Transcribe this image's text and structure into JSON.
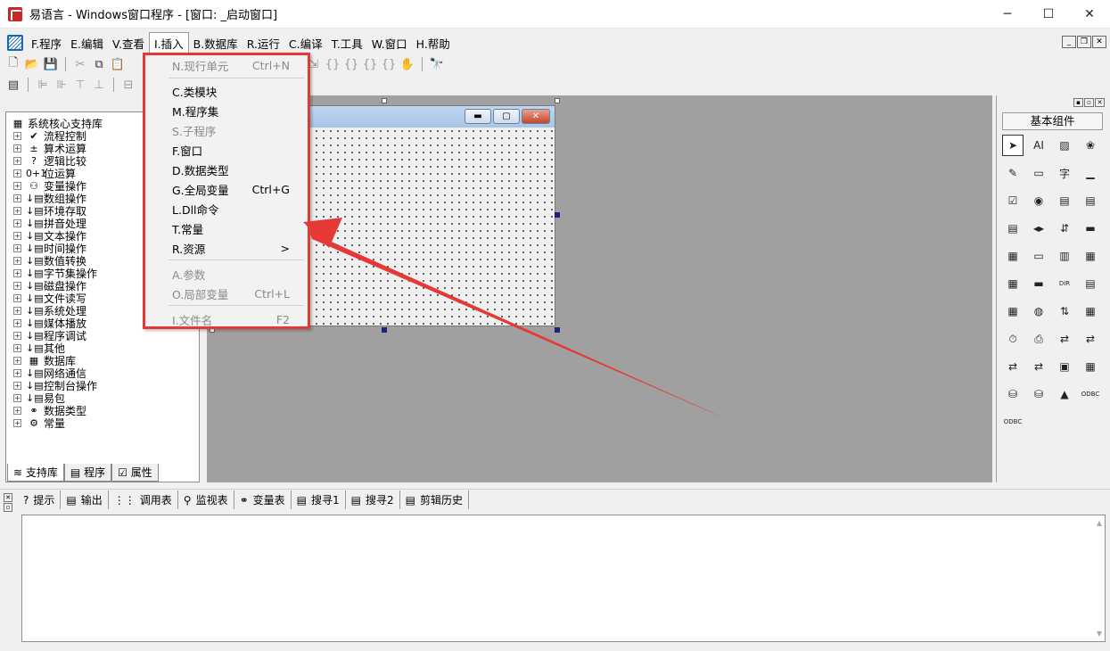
{
  "window": {
    "title": "易语言 - Windows窗口程序 - [窗口: _启动窗口]"
  },
  "menubar": {
    "items": [
      {
        "label": "F.程序",
        "key": "F"
      },
      {
        "label": "E.编辑",
        "key": "E"
      },
      {
        "label": "V.查看",
        "key": "V"
      },
      {
        "label": "I.插入",
        "key": "I"
      },
      {
        "label": "B.数据库",
        "key": "B"
      },
      {
        "label": "R.运行",
        "key": "R"
      },
      {
        "label": "C.编译",
        "key": "C"
      },
      {
        "label": "T.工具",
        "key": "T"
      },
      {
        "label": "W.窗口",
        "key": "W"
      },
      {
        "label": "H.帮助",
        "key": "H"
      }
    ]
  },
  "insert_menu": {
    "items": [
      {
        "label": "N.现行单元",
        "shortcut": "Ctrl+N",
        "enabled": false
      },
      {
        "label": "C.类模块",
        "shortcut": "",
        "enabled": true
      },
      {
        "label": "M.程序集",
        "shortcut": "",
        "enabled": true
      },
      {
        "label": "S.子程序",
        "shortcut": "",
        "enabled": false
      },
      {
        "label": "F.窗口",
        "shortcut": "",
        "enabled": true
      },
      {
        "label": "D.数据类型",
        "shortcut": "",
        "enabled": true
      },
      {
        "label": "G.全局变量",
        "shortcut": "Ctrl+G",
        "enabled": true
      },
      {
        "label": "L.Dll命令",
        "shortcut": "",
        "enabled": true
      },
      {
        "label": "T.常量",
        "shortcut": "",
        "enabled": true
      },
      {
        "label": "R.资源",
        "shortcut": ">",
        "enabled": true
      },
      {
        "label": "A.参数",
        "shortcut": "",
        "enabled": false
      },
      {
        "label": "O.局部变量",
        "shortcut": "Ctrl+L",
        "enabled": false
      },
      {
        "label": "I.文件名",
        "shortcut": "F2",
        "enabled": false
      }
    ]
  },
  "left_panel": {
    "root": "系统核心支持库",
    "items": [
      {
        "label": "流程控制",
        "icon": "✔"
      },
      {
        "label": "算术运算",
        "icon": "±"
      },
      {
        "label": "逻辑比较",
        "icon": "?"
      },
      {
        "label": "位运算",
        "icon": "0+1"
      },
      {
        "label": "变量操作",
        "icon": "⚇"
      },
      {
        "label": "数组操作",
        "icon": "↓▤"
      },
      {
        "label": "环境存取",
        "icon": "↓▤"
      },
      {
        "label": "拼音处理",
        "icon": "↓▤"
      },
      {
        "label": "文本操作",
        "icon": "↓▤"
      },
      {
        "label": "时间操作",
        "icon": "↓▤"
      },
      {
        "label": "数值转换",
        "icon": "↓▤"
      },
      {
        "label": "字节集操作",
        "icon": "↓▤"
      },
      {
        "label": "磁盘操作",
        "icon": "↓▤"
      },
      {
        "label": "文件读写",
        "icon": "↓▤"
      },
      {
        "label": "系统处理",
        "icon": "↓▤"
      },
      {
        "label": "媒体播放",
        "icon": "↓▤"
      },
      {
        "label": "程序调试",
        "icon": "↓▤"
      },
      {
        "label": "其他",
        "icon": "↓▤"
      },
      {
        "label": "数据库",
        "icon": "▦"
      },
      {
        "label": "网络通信",
        "icon": "↓▤"
      },
      {
        "label": "控制台操作",
        "icon": "↓▤"
      },
      {
        "label": "易包",
        "icon": "↓▤"
      },
      {
        "label": "数据类型",
        "icon": "⚭"
      },
      {
        "label": "常量",
        "icon": "⚙"
      }
    ],
    "tabs": [
      {
        "label": "支持库",
        "icon": "≋"
      },
      {
        "label": "程序",
        "icon": "▤"
      },
      {
        "label": "属性",
        "icon": "☑"
      }
    ]
  },
  "right_panel": {
    "header": "基本组件",
    "components": [
      "➤",
      "AI",
      "▨",
      "❀",
      "✎",
      "▭",
      "字",
      "▁",
      "☑",
      "◉",
      "▤",
      "▤",
      "▤",
      "◂▸",
      "⇵",
      "▬",
      "▦",
      "▭",
      "▥",
      "▦",
      "▦",
      "▬",
      "DIR",
      "▤",
      "▦",
      "◍",
      "⇅",
      "▦",
      "⏱",
      "⎙",
      "⇄",
      "⇄",
      "⇄",
      "⇄",
      "▣",
      "▦",
      "⛁",
      "⛁",
      "▲",
      "ODBC",
      "ODBC"
    ],
    "component_names": [
      "pointer",
      "label",
      "picture",
      "shape",
      "edit",
      "frame",
      "text",
      "line",
      "checkbox",
      "radio",
      "list",
      "grid",
      "table",
      "slider",
      "updown",
      "progress",
      "calendar",
      "status",
      "tree",
      "tab",
      "menu",
      "bar",
      "dir",
      "file",
      "drive",
      "web",
      "sort",
      "data",
      "timer",
      "printer",
      "client",
      "server",
      "port",
      "hub",
      "container",
      "split",
      "db-1",
      "db-2",
      "chart",
      "odbc-1",
      "odbc-2"
    ]
  },
  "bottom_tabs": [
    {
      "label": "提示",
      "icon": "?"
    },
    {
      "label": "输出",
      "icon": "▤"
    },
    {
      "label": "调用表",
      "icon": "⋮⋮"
    },
    {
      "label": "监视表",
      "icon": "⚲"
    },
    {
      "label": "变量表",
      "icon": "⚭"
    },
    {
      "label": "搜寻1",
      "icon": "▤"
    },
    {
      "label": "搜寻2",
      "icon": "▤"
    },
    {
      "label": "剪辑历史",
      "icon": "▤"
    }
  ],
  "colors": {
    "highlight": "#e53935",
    "design_bg": "#a0a0a0",
    "selection": "#1a237e"
  }
}
